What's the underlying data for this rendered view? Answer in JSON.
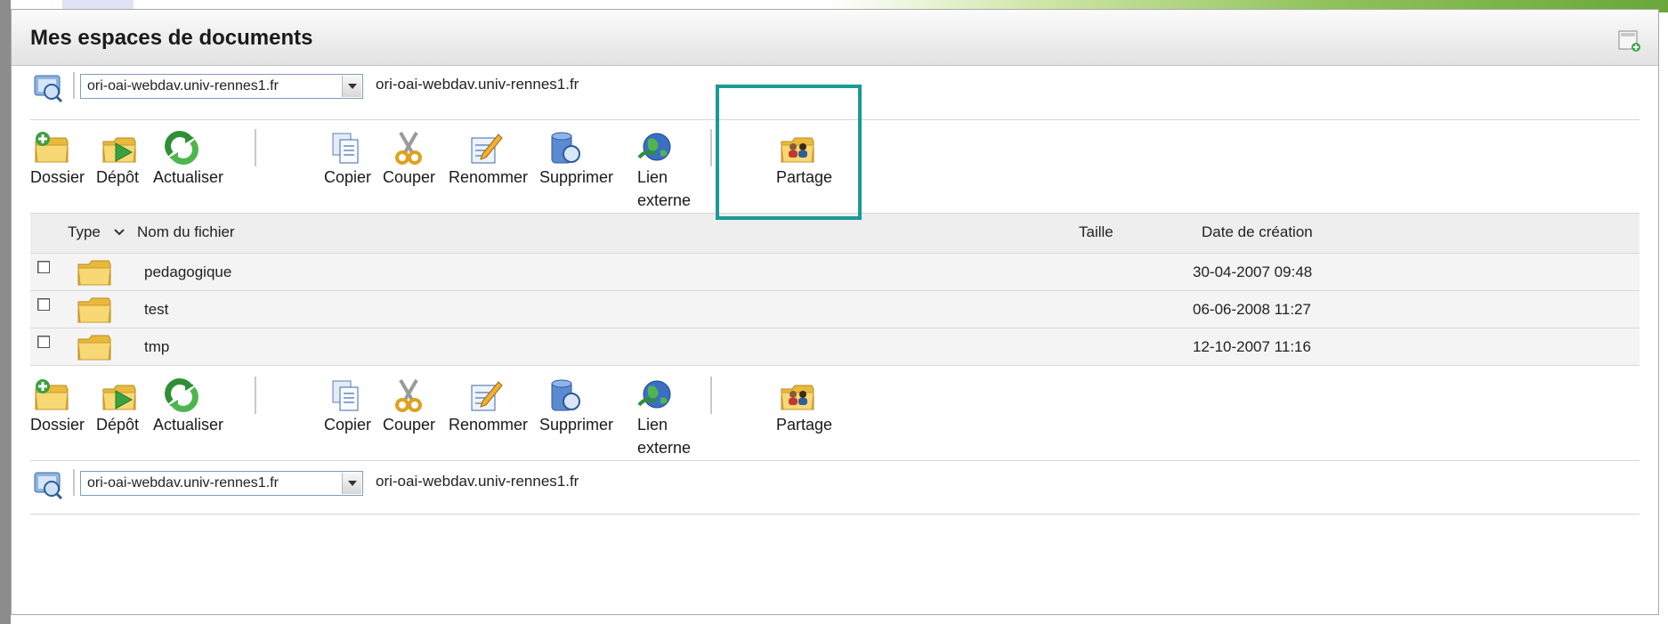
{
  "panel": {
    "title": "Mes espaces de documents"
  },
  "path": {
    "selected": "ori-oai-webdav.univ-rennes1.fr",
    "label": "ori-oai-webdav.univ-rennes1.fr"
  },
  "toolbar": {
    "dossier": "Dossier",
    "depot": "Dépôt",
    "actualiser": "Actualiser",
    "copier": "Copier",
    "couper": "Couper",
    "renommer": "Renommer",
    "supprimer": "Supprimer",
    "lien_line1": "Lien",
    "lien_line2": "externe",
    "partage": "Partage"
  },
  "table": {
    "col_type": "Type",
    "col_name": "Nom du fichier",
    "col_size": "Taille",
    "col_date": "Date de création",
    "rows": [
      {
        "name": "pedagogique",
        "size": "",
        "date": "30-04-2007 09:48"
      },
      {
        "name": "test",
        "size": "",
        "date": "06-06-2008 11:27"
      },
      {
        "name": "tmp",
        "size": "",
        "date": "12-10-2007 11:16"
      }
    ]
  },
  "colors": {
    "highlight": "#1a9a96",
    "folder": "#f3cf5e",
    "toolbar_green": "#3aa042",
    "toolbar_blue": "#3b6fc4"
  },
  "icons": [
    "workspace-icon",
    "new-folder-icon",
    "upload-icon",
    "refresh-icon",
    "copy-icon",
    "cut-icon",
    "rename-icon",
    "delete-icon",
    "external-link-icon",
    "share-icon",
    "folder-icon",
    "sort-chevron-icon"
  ]
}
